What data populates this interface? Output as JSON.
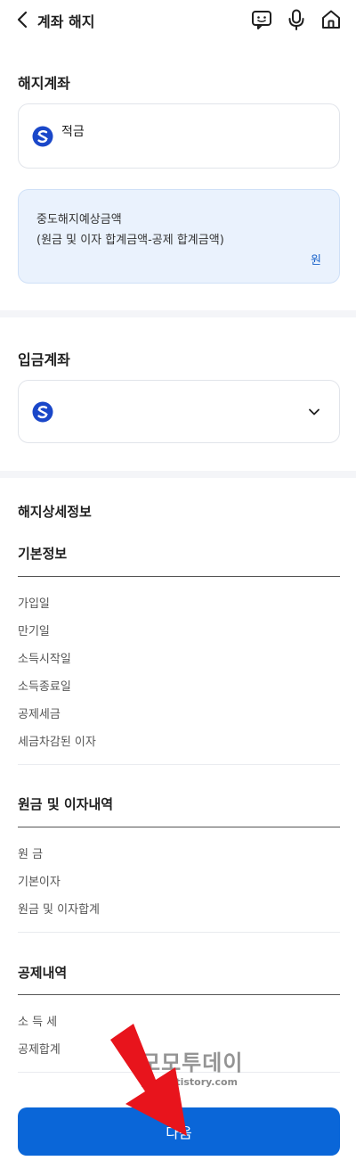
{
  "header": {
    "title": "계좌 해지"
  },
  "closing_account": {
    "section_title": "해지계좌",
    "account_name": "적금",
    "estimate_line1": "중도해지예상금액",
    "estimate_line2": "(원금 및 이자 합계금액-공제 합계금액)",
    "estimate_unit": "원"
  },
  "deposit_account": {
    "section_title": "입금계좌"
  },
  "details": {
    "section_title": "해지상세정보",
    "basic": {
      "title": "기본정보",
      "rows": [
        "가입일",
        "만기일",
        "소득시작일",
        "소득종료일",
        "공제세금",
        "세금차감된 이자"
      ]
    },
    "principal": {
      "title": "원금 및 이자내역",
      "rows": [
        "원 금",
        "기본이자",
        "원금 및 이자합계"
      ]
    },
    "deduction": {
      "title": "공제내역",
      "rows": [
        "소 득 세",
        "공제합계"
      ]
    }
  },
  "watermark": {
    "main": "모모투데이",
    "sub": "pjhhh.tistory.com"
  },
  "next_button": {
    "label": "다음"
  },
  "colors": {
    "accent": "#0a66d8",
    "estimate_bg": "#eaf2fd",
    "logo": "#1a47c9"
  }
}
